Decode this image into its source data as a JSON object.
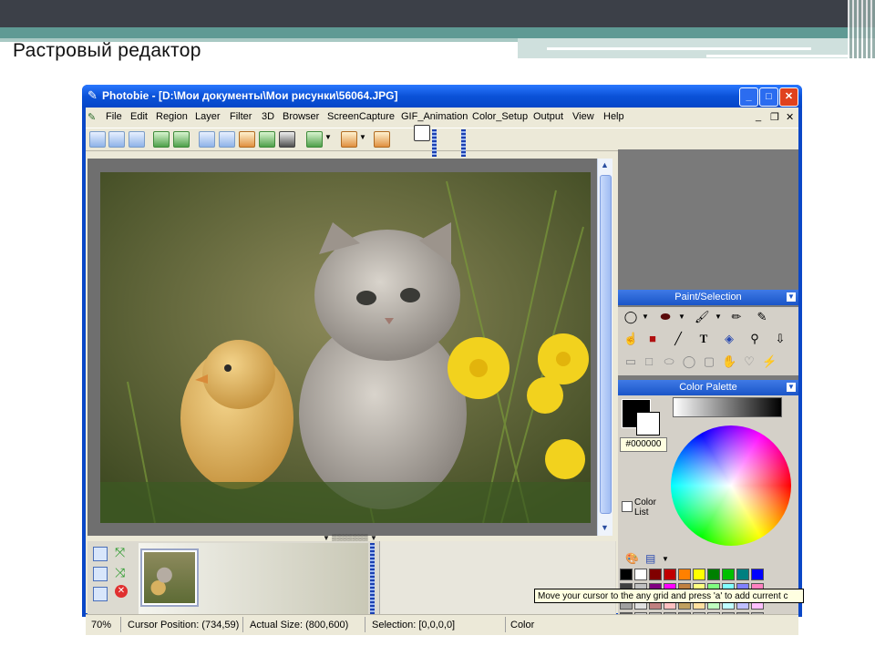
{
  "slide": {
    "title": "Растровый редактор"
  },
  "window": {
    "title": "Photobie - [D:\\Мои документы\\Мои рисунки\\56064.JPG]",
    "controls": {
      "minimize": "_",
      "maximize": "□",
      "close": "✕"
    }
  },
  "menu": [
    "File",
    "Edit",
    "Region",
    "Layer",
    "Filter",
    "3D",
    "Browser",
    "ScreenCapture",
    "GIF_Animation",
    "Color_Setup",
    "Output",
    "View",
    "Help"
  ],
  "panels": {
    "paint": {
      "title": "Paint/Selection"
    },
    "palette": {
      "title": "Color Palette",
      "current_hex": "#000000",
      "color_list_label": "Color\nList"
    }
  },
  "status": {
    "zoom": "70%",
    "cursor": "Cursor Position: (734,59)",
    "actual": "Actual Size: (800,600)",
    "selection": "Selection: [0,0,0,0]",
    "color": "Color"
  },
  "tooltip": "Move your cursor to the any grid and press 'a' to add current c",
  "colors": {
    "titlebar": "#0b52d8",
    "panel_header": "#1a55c8",
    "chrome": "#ece9d8"
  }
}
